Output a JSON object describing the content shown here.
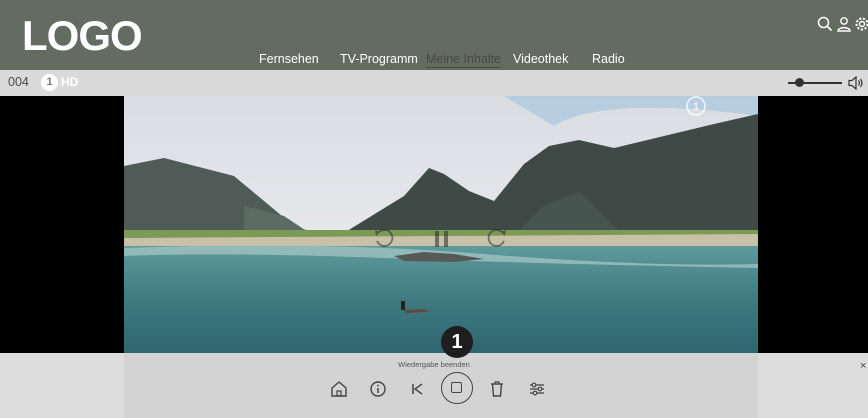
{
  "header": {
    "logo": "LOGO",
    "nav": [
      "Fernsehen",
      "TV-Programm",
      "Meine Inhalte",
      "Videothek",
      "Radio"
    ],
    "active_nav": "Meine Inhalte",
    "icons": [
      "search-icon",
      "user-icon",
      "gear-icon"
    ]
  },
  "channel": {
    "number": "004",
    "logo_glyph": "1",
    "quality": "HD",
    "volume": 0.15
  },
  "player": {
    "overlay_controls": [
      "rewind-icon",
      "pause-icon",
      "forward-icon"
    ],
    "watermark_quality": "HD",
    "marker": "1",
    "tooltip": "Wiedergabe beenden",
    "close": "×",
    "buttons": [
      "home-icon",
      "info-icon",
      "skip-back-icon",
      "stop-icon",
      "trash-icon",
      "settings-sliders-icon"
    ]
  },
  "colors": {
    "header_bg": "#646b61",
    "active_nav": "#454b43",
    "bottom_bar": "#dcdcdc"
  }
}
